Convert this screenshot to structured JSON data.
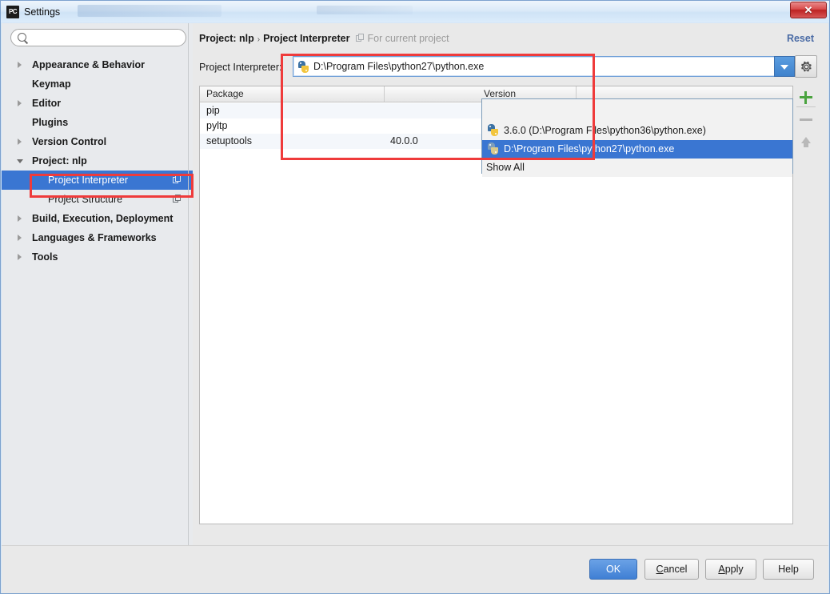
{
  "window": {
    "title": "Settings",
    "app_icon": "PC",
    "close_label": "✕"
  },
  "sidebar": {
    "search": {
      "value": "",
      "placeholder": ""
    },
    "items": [
      {
        "label": "Appearance & Behavior",
        "expander": "right",
        "child": false,
        "selected": false,
        "copy_icon": false
      },
      {
        "label": "Keymap",
        "expander": "none",
        "child": false,
        "selected": false,
        "copy_icon": false
      },
      {
        "label": "Editor",
        "expander": "right",
        "child": false,
        "selected": false,
        "copy_icon": false
      },
      {
        "label": "Plugins",
        "expander": "none",
        "child": false,
        "selected": false,
        "copy_icon": false
      },
      {
        "label": "Version Control",
        "expander": "right",
        "child": false,
        "selected": false,
        "copy_icon": false
      },
      {
        "label": "Project: nlp",
        "expander": "down",
        "child": false,
        "selected": false,
        "copy_icon": false
      },
      {
        "label": "Project Interpreter",
        "expander": "none",
        "child": true,
        "selected": true,
        "copy_icon": true
      },
      {
        "label": "Project Structure",
        "expander": "none",
        "child": true,
        "selected": false,
        "copy_icon": true
      },
      {
        "label": "Build, Execution, Deployment",
        "expander": "right",
        "child": false,
        "selected": false,
        "copy_icon": false
      },
      {
        "label": "Languages & Frameworks",
        "expander": "right",
        "child": false,
        "selected": false,
        "copy_icon": false
      },
      {
        "label": "Tools",
        "expander": "right",
        "child": false,
        "selected": false,
        "copy_icon": false
      }
    ]
  },
  "header": {
    "crumb_root": "Project: nlp",
    "crumb_sep": "›",
    "crumb_leaf": "Project Interpreter",
    "scope_note": "For current project",
    "reset_label": "Reset"
  },
  "interpreter": {
    "field_label": "Project Interpreter:",
    "selected_value": "D:\\Program Files\\python27\\python.exe",
    "dropdown_open": true,
    "options": [
      {
        "label": "3.6.0 (D:\\Program Files\\python36\\python.exe)",
        "selected": false,
        "has_icon": true
      },
      {
        "label": "D:\\Program Files\\python27\\python.exe",
        "selected": true,
        "has_icon": true
      },
      {
        "label": "Show All",
        "selected": false,
        "has_icon": false
      }
    ],
    "gear_icon": "gear-icon"
  },
  "packages": {
    "columns": [
      "Package",
      "Version"
    ],
    "rows": [
      {
        "name": "pip",
        "version": ""
      },
      {
        "name": "pyltp",
        "version": ""
      },
      {
        "name": "setuptools",
        "version": "40.0.0"
      }
    ],
    "toolbar": [
      {
        "name": "add-package-button",
        "icon": "plus-icon",
        "enabled": true
      },
      {
        "name": "remove-package-button",
        "icon": "minus-icon",
        "enabled": false
      },
      {
        "name": "upgrade-package-button",
        "icon": "arrow-up-icon",
        "enabled": false
      }
    ]
  },
  "footer": {
    "ok": "OK",
    "cancel_pre": "",
    "cancel_mnemonic": "C",
    "cancel_post": "ancel",
    "apply_pre": "",
    "apply_mnemonic": "A",
    "apply_post": "pply",
    "help": "Help"
  },
  "colors": {
    "accent_blue": "#3a76d2",
    "annotation_red": "#ef3b3b",
    "link_blue": "#4a6ba5",
    "add_green": "#4aa33f"
  }
}
